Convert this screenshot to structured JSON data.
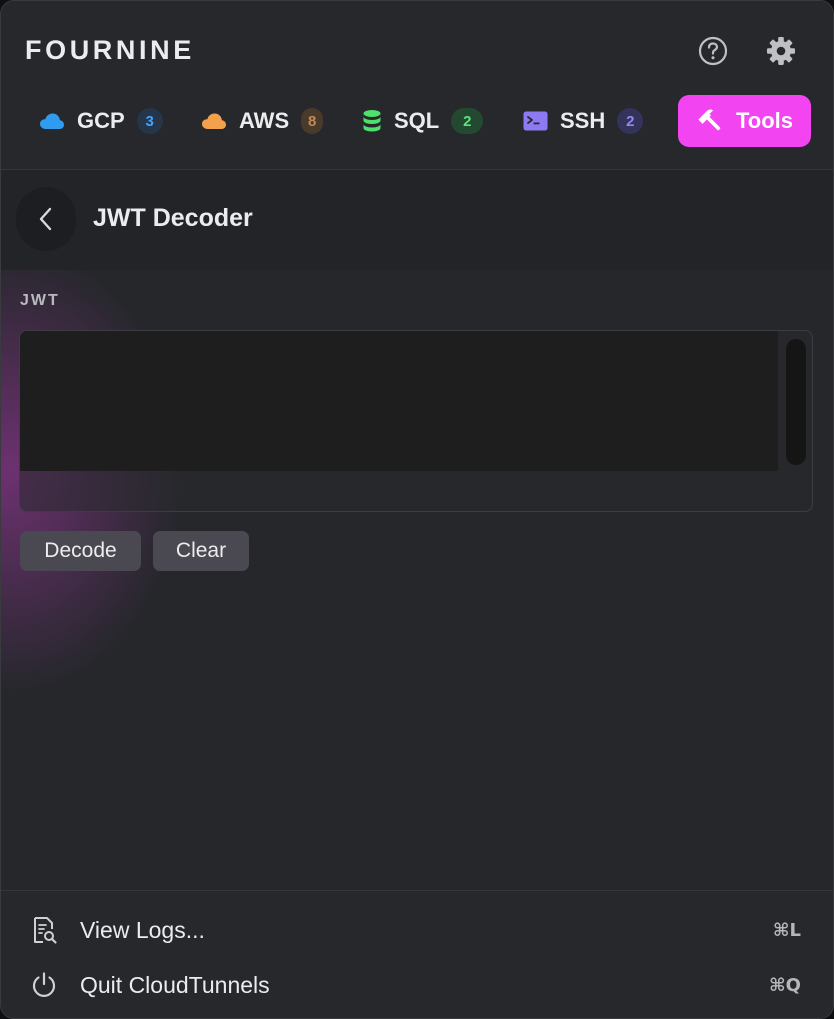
{
  "header": {
    "brand": "FOURNINE",
    "help_icon": "help-circle-icon",
    "settings_icon": "gear-icon"
  },
  "tabs": [
    {
      "label": "GCP",
      "icon": "cloud-icon",
      "icon_color": "#2f9cf0",
      "badge": "3",
      "badge_bg": "#25364a",
      "badge_color": "#3ea5ff"
    },
    {
      "label": "AWS",
      "icon": "cloud-icon",
      "icon_color": "#f3a24b",
      "badge": "8",
      "badge_bg": "#4a3a2c",
      "badge_color": "#c28a55"
    },
    {
      "label": "SQL",
      "icon": "database-icon",
      "icon_color": "#4ee06a",
      "badge": "2",
      "badge_bg": "#234a30",
      "badge_color": "#5ee07a"
    },
    {
      "label": "SSH",
      "icon": "terminal-icon",
      "icon_color": "#8d7af3",
      "badge": "2",
      "badge_bg": "#34335a",
      "badge_color": "#8e8af0"
    },
    {
      "label": "Tools",
      "icon": "hammer-icon",
      "active": true,
      "active_bg": "#f244f0"
    }
  ],
  "subbar": {
    "back_icon": "chevron-left-icon",
    "title": "JWT Decoder"
  },
  "jwt": {
    "label": "JWT",
    "value": "",
    "placeholder": ""
  },
  "buttons": {
    "decode": "Decode",
    "clear": "Clear"
  },
  "footer": {
    "items": [
      {
        "label": "View Logs...",
        "shortcut": "⌘L",
        "icon": "log-search-icon"
      },
      {
        "label": "Quit CloudTunnels",
        "shortcut": "⌘Q",
        "icon": "power-icon"
      }
    ]
  }
}
